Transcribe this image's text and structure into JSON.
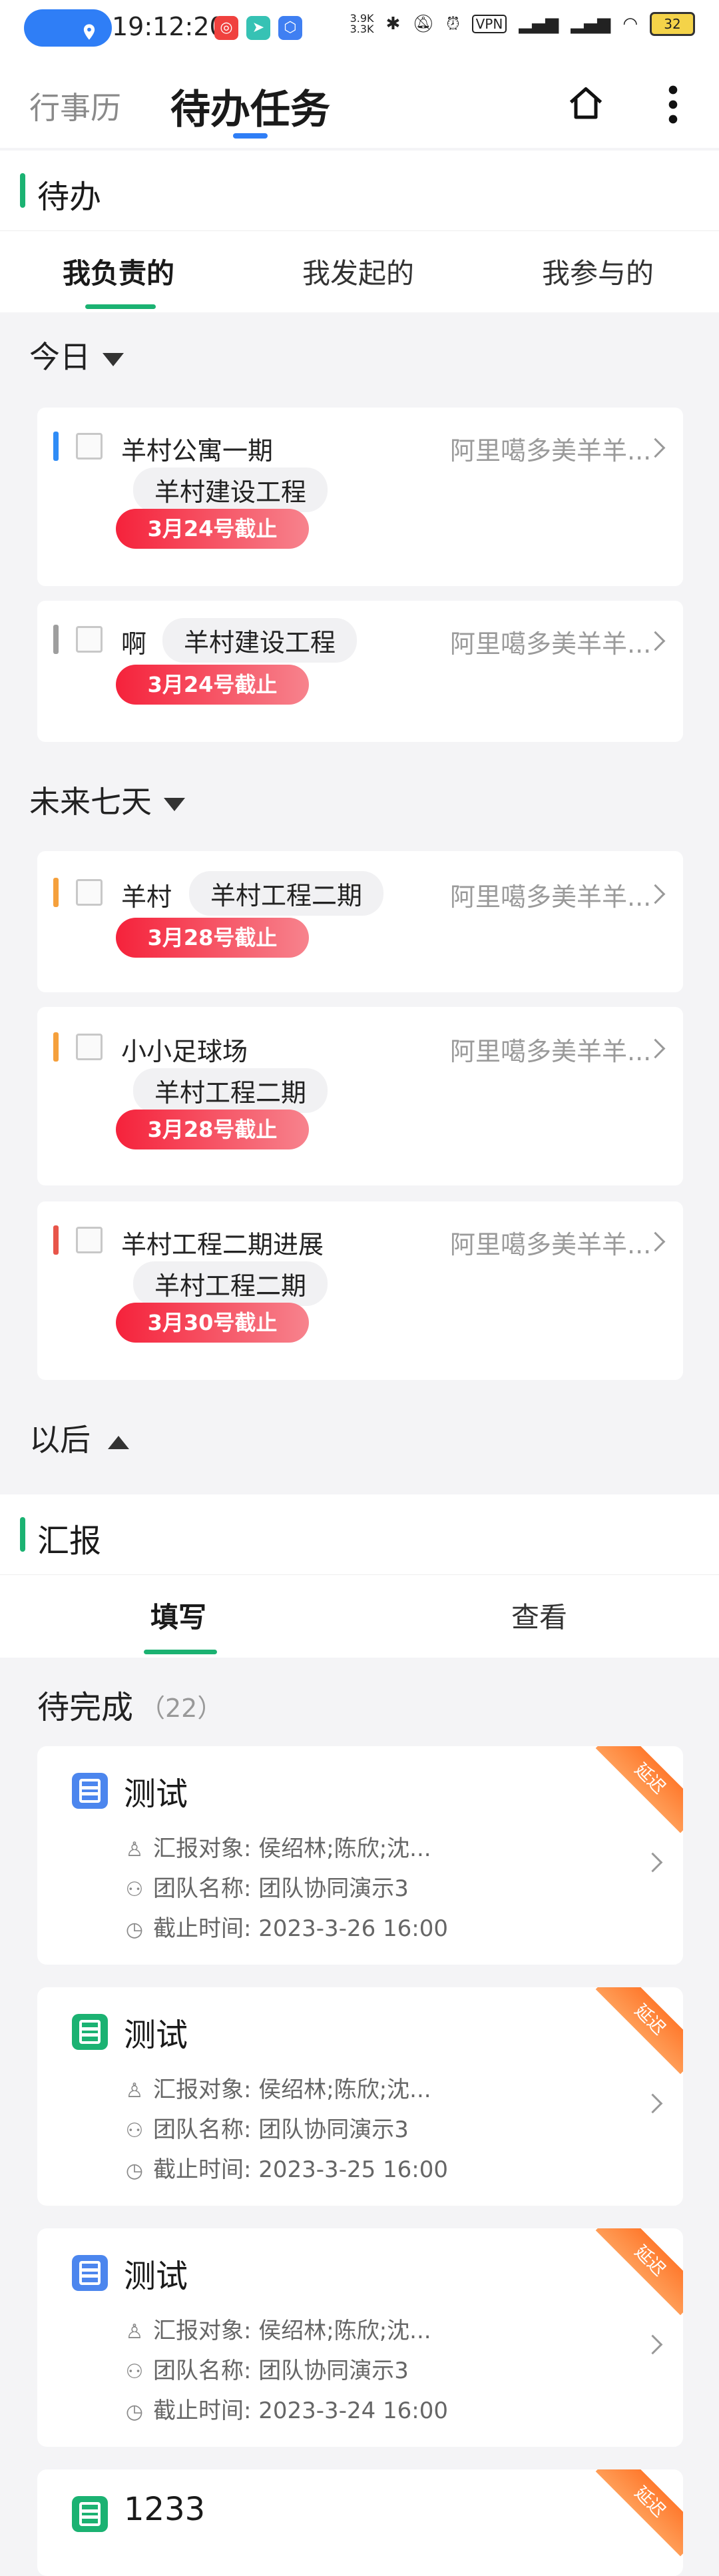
{
  "status_bar": {
    "time": "19:12:20",
    "net_speed_up": "3.9K",
    "net_speed_down": "3.3K",
    "vpn": "VPN",
    "battery": "32"
  },
  "header": {
    "tab_calendar": "行事历",
    "tab_todo": "待办任务"
  },
  "todo_section": {
    "title": "待办",
    "tabs": [
      "我负责的",
      "我发起的",
      "我参与的"
    ],
    "groups": [
      {
        "label": "今日",
        "tasks": [
          {
            "title": "羊村公寓一期",
            "project": "羊村建设工程",
            "deadline": "3月24号截止",
            "owner": "阿里噶多美羊羊...",
            "stripe_color": "#2f8cf6"
          },
          {
            "title": "啊",
            "project": "羊村建设工程",
            "deadline": "3月24号截止",
            "owner": "阿里噶多美羊羊...",
            "stripe_color": "#9e9e9e"
          }
        ]
      },
      {
        "label": "未来七天",
        "tasks": [
          {
            "title": "羊村",
            "project": "羊村工程二期",
            "deadline": "3月28号截止",
            "owner": "阿里噶多美羊羊...",
            "stripe_color": "#f5a03c"
          },
          {
            "title": "小小足球场",
            "project": "羊村工程二期",
            "deadline": "3月28号截止",
            "owner": "阿里噶多美羊羊...",
            "stripe_color": "#f5a03c"
          },
          {
            "title": "羊村工程二期进展",
            "project": "羊村工程二期",
            "deadline": "3月30号截止",
            "owner": "阿里噶多美羊羊...",
            "stripe_color": "#e8554a"
          }
        ]
      },
      {
        "label": "以后"
      }
    ]
  },
  "report_section": {
    "title": "汇报",
    "tabs": [
      "填写",
      "查看"
    ],
    "pending_label": "待完成",
    "pending_count": "（22）",
    "reports": [
      {
        "title": "测试",
        "target": "汇报对象: 侯绍林;陈欣;沈...",
        "team": "团队名称: 团队协同演示3",
        "deadline": "截止时间: 2023-3-26   16:00",
        "badge": "延迟",
        "icon_color": "#4c86ee"
      },
      {
        "title": "测试",
        "target": "汇报对象: 侯绍林;陈欣;沈...",
        "team": "团队名称: 团队协同演示3",
        "deadline": "截止时间: 2023-3-25   16:00",
        "badge": "延迟",
        "icon_color": "#1bb272"
      },
      {
        "title": "测试",
        "target": "汇报对象: 侯绍林;陈欣;沈...",
        "team": "团队名称: 团队协同演示3",
        "deadline": "截止时间: 2023-3-24   16:00",
        "badge": "延迟",
        "icon_color": "#4c86ee"
      },
      {
        "title": "1233",
        "badge": "延迟",
        "icon_color": "#1bb272"
      }
    ]
  }
}
